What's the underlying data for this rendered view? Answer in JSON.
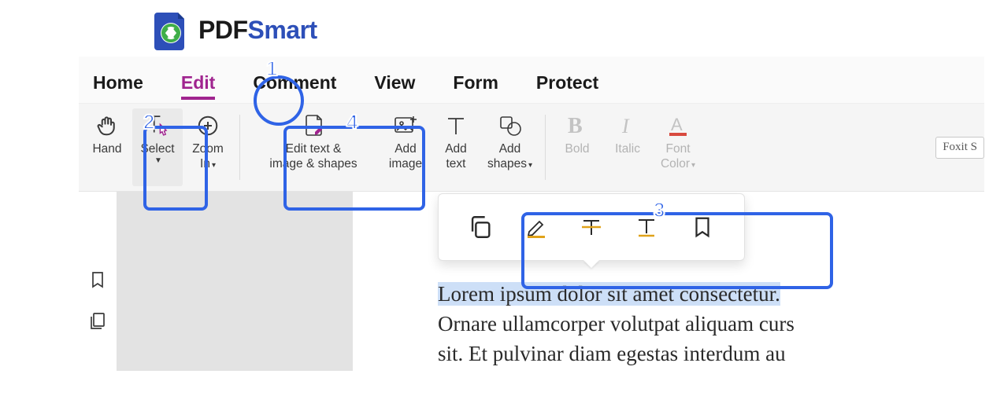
{
  "brand": {
    "name_a": "PDF",
    "name_b": "Smart"
  },
  "tabs": {
    "home": "Home",
    "edit": "Edit",
    "comment": "Comment",
    "view": "View",
    "form": "Form",
    "protect": "Protect",
    "active": "edit"
  },
  "ribbon": {
    "hand": "Hand",
    "select": "Select",
    "zoom_in": "Zoom\nIn",
    "edit_text_image_shapes": "Edit text &\nimage & shapes",
    "add_image": "Add\nimage",
    "add_text": "Add\ntext",
    "add_shapes": "Add\nshapes",
    "bold": "Bold",
    "italic": "Italic",
    "font_color": "Font\nColor",
    "font_name_preview": "Foxit S"
  },
  "context_toolbar": {
    "tools": [
      "copy",
      "highlight",
      "strikethrough",
      "text-tool",
      "bookmark"
    ]
  },
  "document": {
    "line1_selected": "Lorem ipsum dolor sit amet consectetur.",
    "line2": "Ornare ullamcorper volutpat aliquam curs",
    "line3": "sit. Et pulvinar diam egestas interdum au"
  },
  "annotations": {
    "1": "1",
    "2": "2",
    "3": "3",
    "4": "4"
  },
  "colors": {
    "accent_annotation": "#2f63e6",
    "tab_active": "#a0248f",
    "highlight": "#cddff7",
    "marker_accent": "#e0a21a"
  }
}
